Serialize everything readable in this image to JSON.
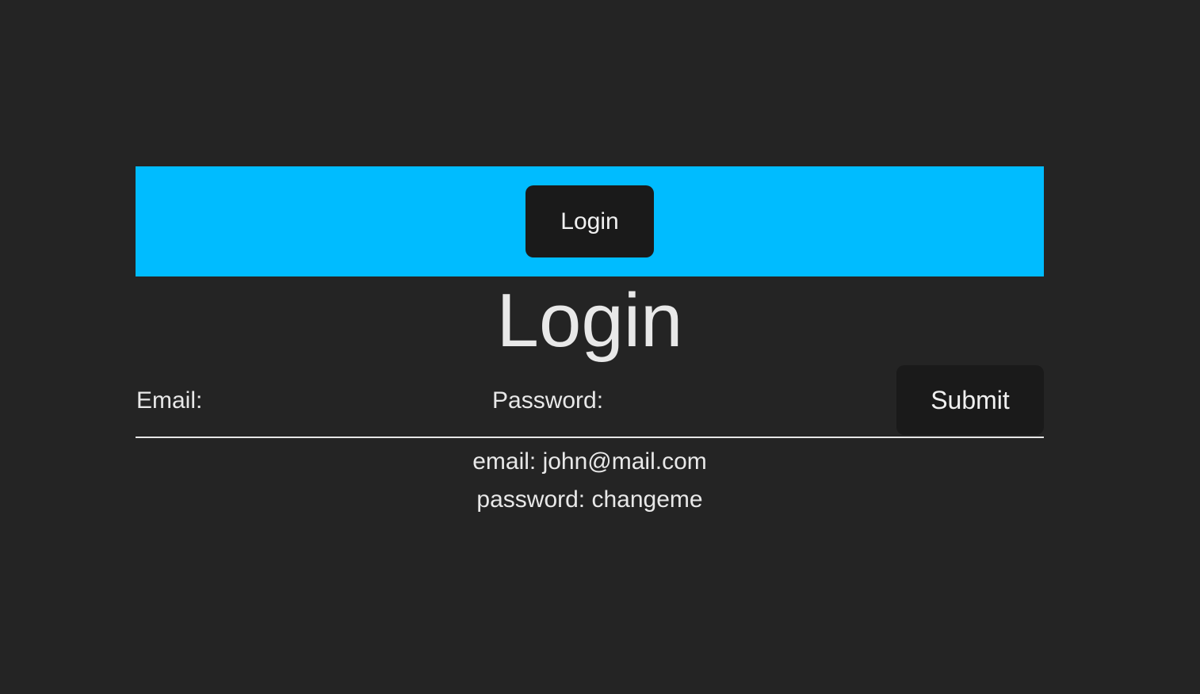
{
  "nav": {
    "button_label": "Login",
    "accent_color": "#00bcff"
  },
  "page": {
    "title": "Login"
  },
  "form": {
    "email_label": "Email:",
    "email_value": "",
    "password_label": "Password:",
    "password_value": "",
    "submit_label": "Submit"
  },
  "hints": {
    "email": "email: john@mail.com",
    "password": "password: changeme"
  }
}
